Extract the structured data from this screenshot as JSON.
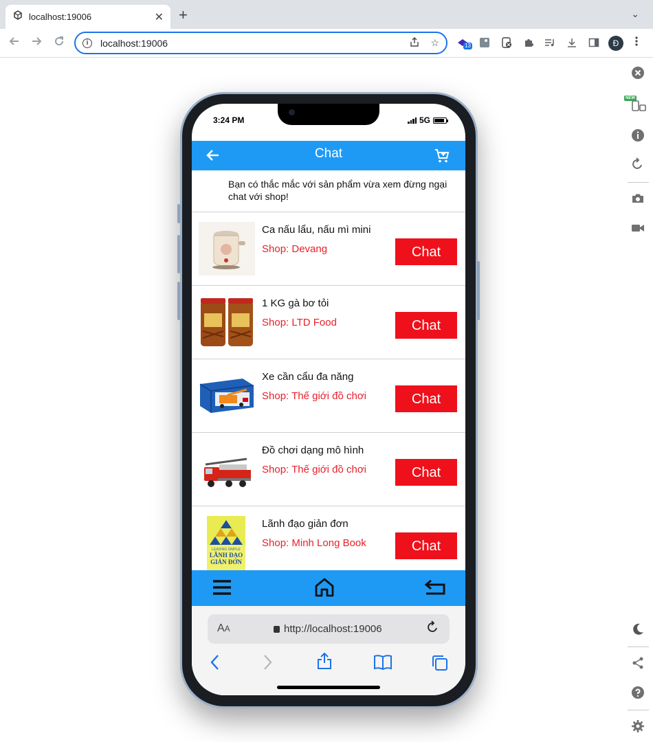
{
  "browser": {
    "tab_title": "localhost:19006",
    "tab_close": "✕",
    "new_tab": "+",
    "tab_menu": "⌄",
    "url": "localhost:19006",
    "extension_badge": "13",
    "profile_initial": "Đ"
  },
  "status_bar": {
    "time": "3:24 PM",
    "network": "5G"
  },
  "header": {
    "title": "Chat",
    "back_icon": "arrow-left-icon",
    "cart_icon": "cart-icon"
  },
  "intro_text": "Bạn có thắc mắc với sản phẩm vừa xem đừng ngại chat với shop!",
  "products": [
    {
      "name": "Ca nấu lẩu, nấu mì mini",
      "shop": "Shop: Devang",
      "button": "Chat"
    },
    {
      "name": "1 KG gà bơ tỏi",
      "shop": "Shop: LTD Food",
      "button": "Chat"
    },
    {
      "name": "Xe cần cẩu đa năng",
      "shop": "Shop: Thế giới đồ chơi",
      "button": "Chat"
    },
    {
      "name": "Đồ chơi dạng mô hình",
      "shop": "Shop: Thế giới đồ chơi",
      "button": "Chat"
    },
    {
      "name": "Lãnh đạo giản đơn",
      "shop": "Shop: Minh Long Book",
      "button": "Chat"
    }
  ],
  "book_cover": {
    "top_text": "LEADING SIMPLE",
    "title_1": "LÃNH ĐẠO",
    "title_2": "GIẢN ĐƠN"
  },
  "safari": {
    "aa_label": "A",
    "aa_small": "A",
    "url": "http://localhost:19006"
  },
  "colors": {
    "header_blue": "#1e9af5",
    "chat_red": "#ee111b",
    "shop_red": "#e8202a"
  }
}
